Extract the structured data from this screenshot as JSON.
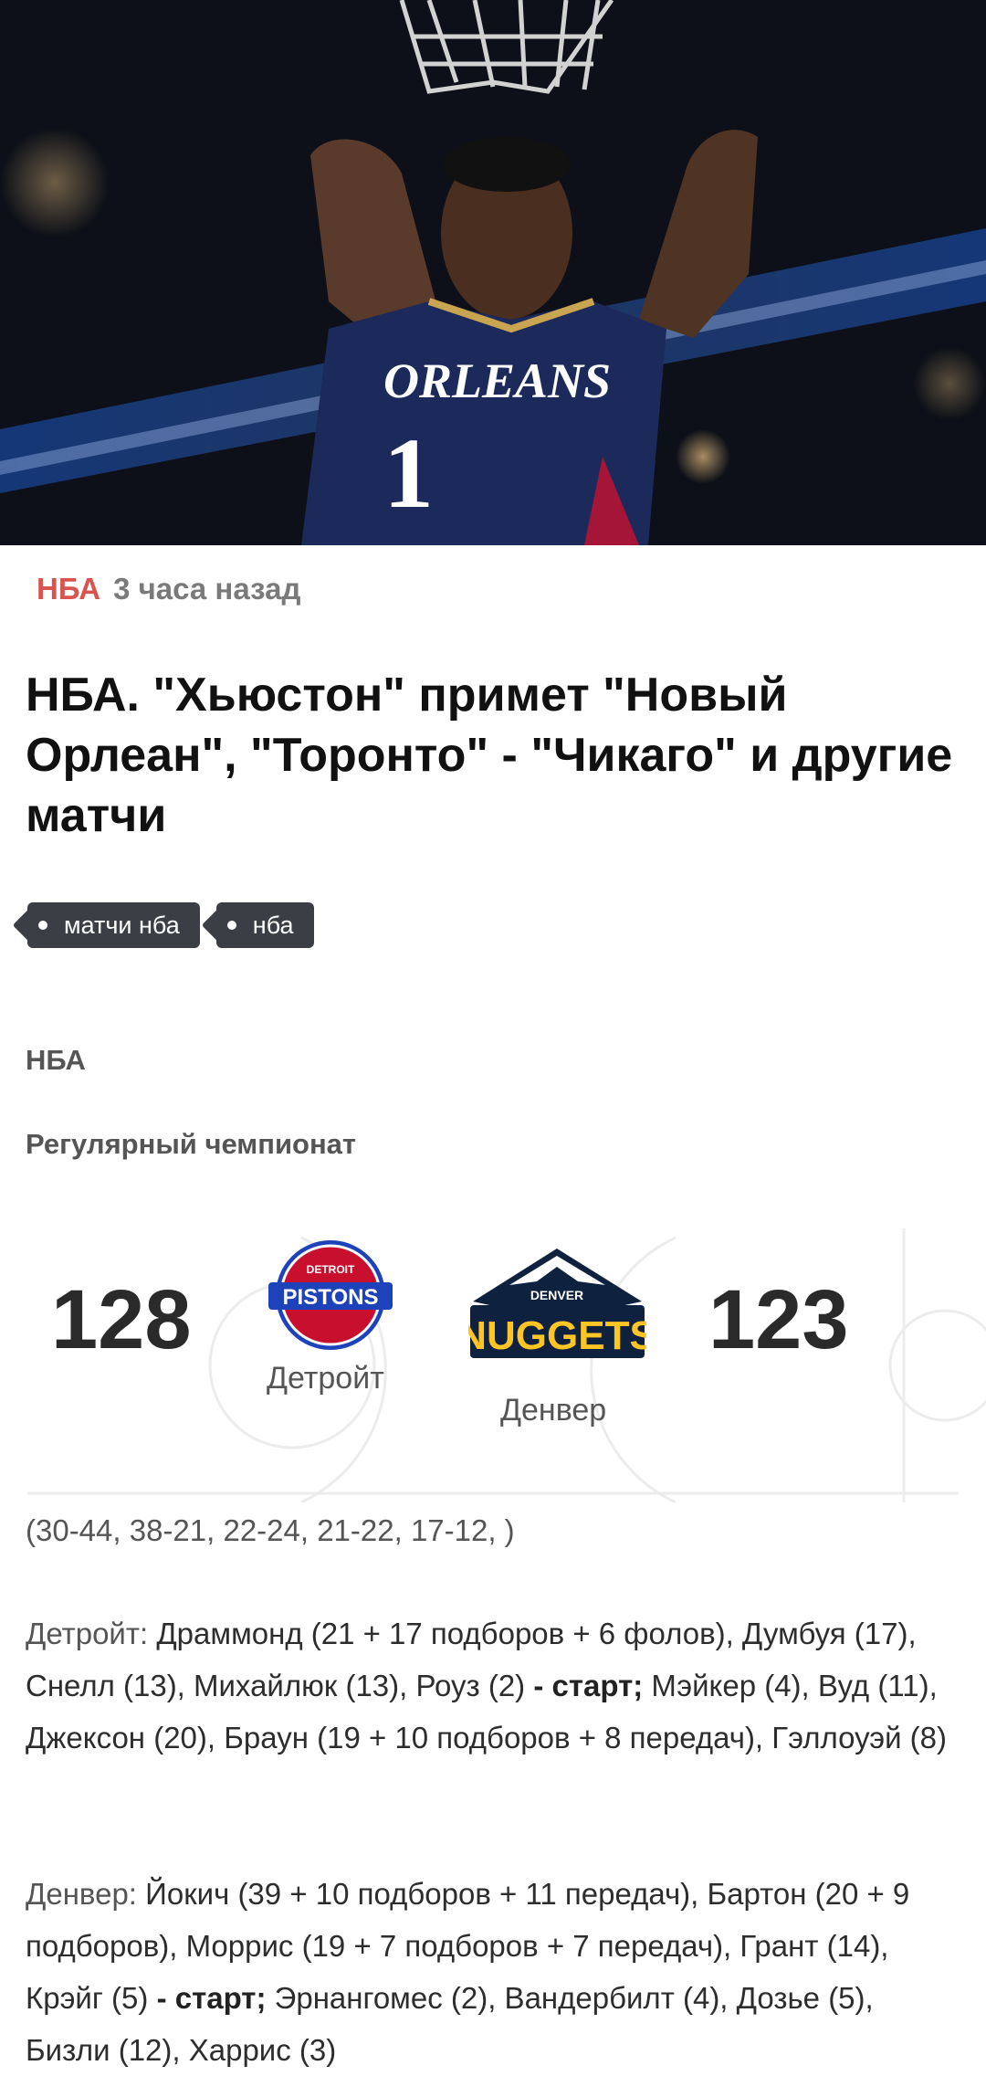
{
  "article": {
    "category": "НБА",
    "time_ago": "3 часа назад",
    "title": "НБА. \"Хьюстон\" примет \"Новый Орлеан\", \"Торонто\" - \"Чикаго\" и другие матчи",
    "tags": [
      "матчи нба",
      "нба"
    ]
  },
  "hero": {
    "jersey_text": "ORLEANS",
    "jersey_number": "1"
  },
  "league": "НБА",
  "stage": "Регулярный чемпионат",
  "match": {
    "home": {
      "name": "Детройт",
      "score": "128",
      "logo_top": "DETROIT",
      "logo_main": "PISTONS",
      "color": "#c8102e"
    },
    "away": {
      "name": "Денвер",
      "score": "123",
      "logo_top": "DENVER",
      "logo_main": "NUGGETS",
      "color": "#fec524"
    },
    "quarters": "(30-44, 38-21, 22-24, 21-22, 17-12, )"
  },
  "lineups": {
    "detroit_label": "Детройт:",
    "detroit_p1": " Драммонд (21 + 17 подборов + 6 фолов), Думбуя (17), Снелл (13), Михайлюк (13), Роуз (2) ",
    "detroit_start": "- старт;",
    "detroit_p2": " Мэйкер (4), Вуд (11), Джексон (20), Браун (19 + 10 подборов + 8 передач), Гэллоуэй (8)",
    "denver_label": "Денвер:",
    "denver_p1": " Йокич (39 + 10 подборов + 11 передач), Бартон (20 + 9 подборов), Моррис (19 + 7 подборов + 7 передач), Грант (14), Крэйг (5) ",
    "denver_start": "- старт;",
    "denver_p2": " Эрнангомес (2), Вандербилт (4), Дозье (5), Бизли (12), Харрис (3)"
  }
}
